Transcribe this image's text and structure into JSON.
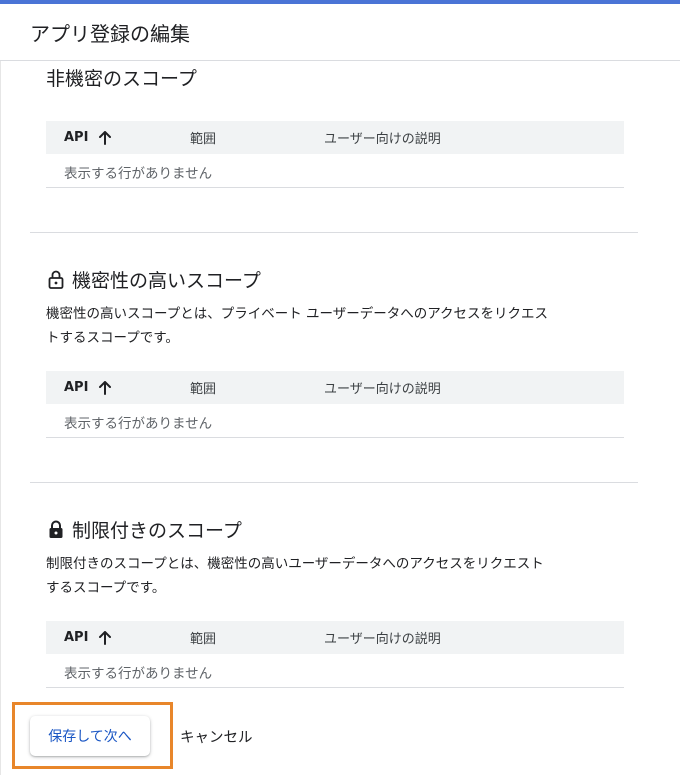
{
  "header": {
    "title": "アプリ登録の編集"
  },
  "table_headers": {
    "api": "API",
    "scope": "範囲",
    "description": "ユーザー向けの説明"
  },
  "sections": [
    {
      "title": "非機密のスコープ",
      "empty_text": "表示する行がありません"
    },
    {
      "title": "機密性の高いスコープ",
      "icon": "lock-open-icon",
      "description_line1": "機密性の高いスコープとは、プライベート ユーザーデータへのアクセスをリクエス",
      "description_line2": "トするスコープです。",
      "empty_text": "表示する行がありません"
    },
    {
      "title": "制限付きのスコープ",
      "icon": "lock-icon",
      "description_line1": "制限付きのスコープとは、機密性の高いユーザーデータへのアクセスをリクエスト",
      "description_line2": "するスコープです。",
      "empty_text": "表示する行がありません"
    }
  ],
  "actions": {
    "save_next": "保存して次へ",
    "cancel": "キャンセル"
  },
  "colors": {
    "accent_top": "#4a74d6",
    "highlight": "#e8862a",
    "primary_text": "#1a56c4"
  }
}
